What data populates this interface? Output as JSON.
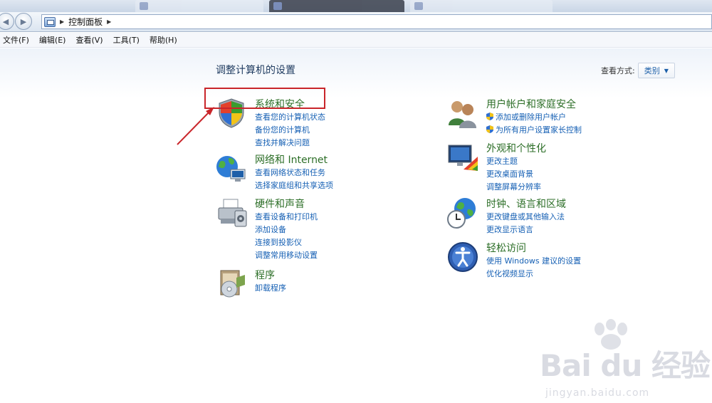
{
  "breadcrumb": {
    "root": "控制面板"
  },
  "menu": [
    "文件(F)",
    "编辑(E)",
    "查看(V)",
    "工具(T)",
    "帮助(H)"
  ],
  "page": {
    "title": "调整计算机的设置",
    "view_by_label": "查看方式:",
    "view_by_value": "类别"
  },
  "categories": {
    "system": {
      "title": "系统和安全",
      "links": [
        "查看您的计算机状态",
        "备份您的计算机",
        "查找并解决问题"
      ]
    },
    "network": {
      "title": "网络和 Internet",
      "links": [
        "查看网络状态和任务",
        "选择家庭组和共享选项"
      ]
    },
    "hardware": {
      "title": "硬件和声音",
      "links": [
        "查看设备和打印机",
        "添加设备",
        "连接到投影仪",
        "调整常用移动设置"
      ]
    },
    "programs": {
      "title": "程序",
      "links": [
        "卸载程序"
      ]
    },
    "users": {
      "title": "用户帐户和家庭安全",
      "links": [
        "添加或删除用户帐户",
        "为所有用户设置家长控制"
      ]
    },
    "appearance": {
      "title": "外观和个性化",
      "links": [
        "更改主题",
        "更改桌面背景",
        "调整屏幕分辨率"
      ]
    },
    "clock": {
      "title": "时钟、语言和区域",
      "links": [
        "更改键盘或其他输入法",
        "更改显示语言"
      ]
    },
    "ease": {
      "title": "轻松访问",
      "links": [
        "使用 Windows 建议的设置",
        "优化视频显示"
      ]
    }
  },
  "watermark": {
    "logo": "Bai du 经验",
    "url": "jingyan.baidu.com"
  },
  "colors": {
    "category_title": "#2c6e27",
    "link": "#1660b4",
    "annotation": "#c9252a"
  }
}
